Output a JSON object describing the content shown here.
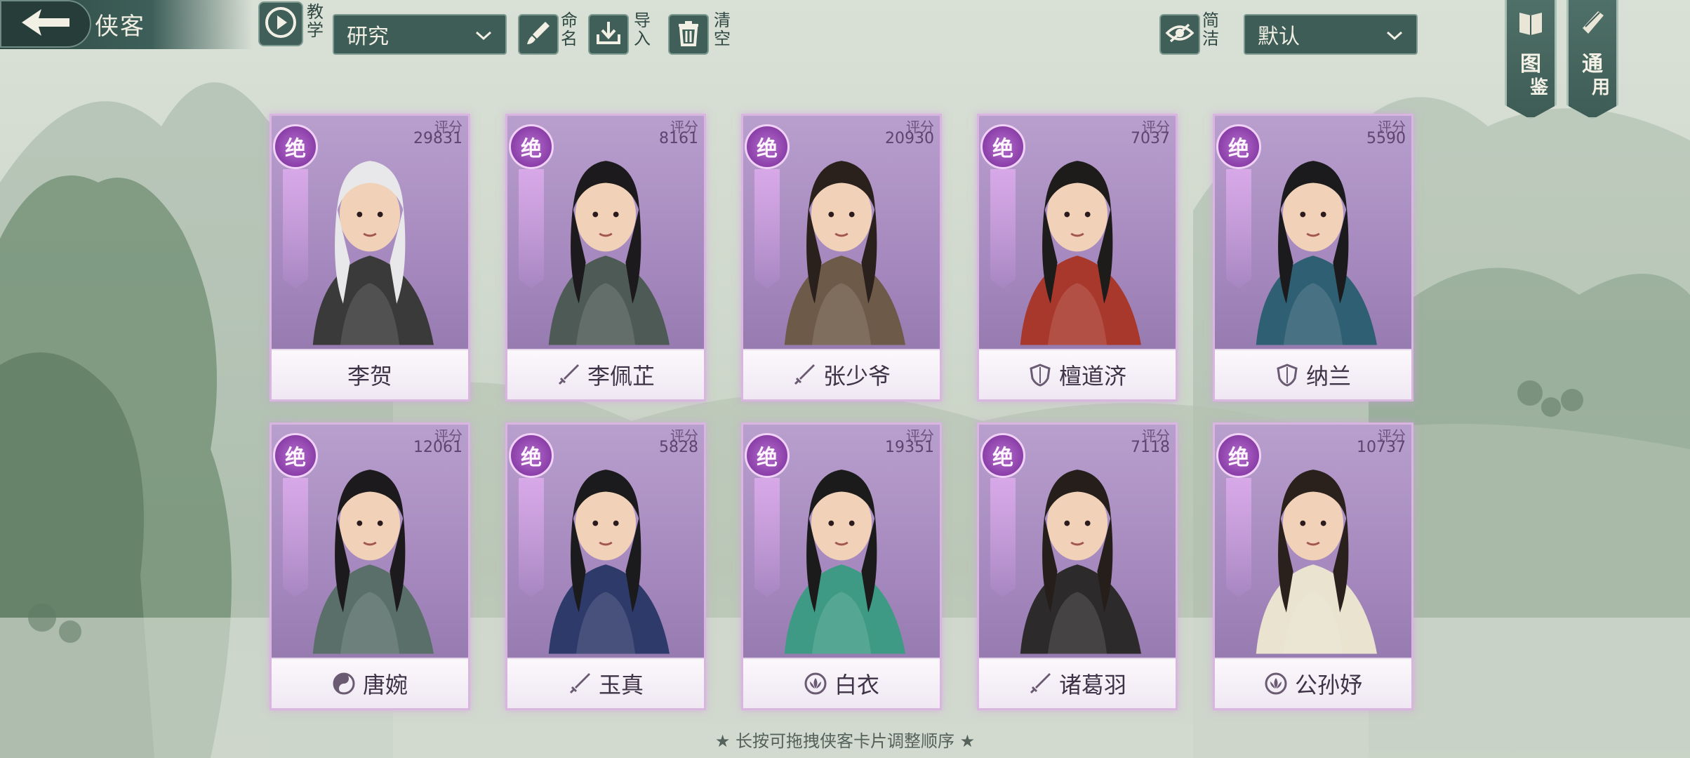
{
  "header": {
    "title": "侠客",
    "tutorial_label": "教学",
    "rename_label": "命名",
    "import_label": "导入",
    "clear_label": "清空",
    "simple_label": "简洁",
    "filter_dropdown": {
      "selected": "研究"
    },
    "sort_dropdown": {
      "selected": "默认"
    }
  },
  "bookmarks": [
    {
      "label_top": "图",
      "label_bottom": "鉴"
    },
    {
      "label_top": "通",
      "label_bottom": "用"
    }
  ],
  "score_label": "评分",
  "rank_label": "绝",
  "cards": [
    {
      "name": "李贺",
      "score": "29831",
      "class_icon": "none",
      "robe": "#3b3a3a",
      "hair": "#e8e8ea"
    },
    {
      "name": "李佩芷",
      "score": "8161",
      "class_icon": "sword-icon",
      "robe": "#4e5a56",
      "hair": "#1c1a1c"
    },
    {
      "name": "张少爷",
      "score": "20930",
      "class_icon": "sword-icon",
      "robe": "#6e5a48",
      "hair": "#2a211c"
    },
    {
      "name": "檀道济",
      "score": "7037",
      "class_icon": "shield-icon",
      "robe": "#a8382c",
      "hair": "#1e1b1b"
    },
    {
      "name": "纳兰",
      "score": "5590",
      "class_icon": "shield-icon",
      "robe": "#2f5f73",
      "hair": "#1b1b1e"
    },
    {
      "name": "唐婉",
      "score": "12061",
      "class_icon": "taiji-icon",
      "robe": "#5b6f6a",
      "hair": "#1d1a1d"
    },
    {
      "name": "玉真",
      "score": "5828",
      "class_icon": "sword-icon",
      "robe": "#2e3a6a",
      "hair": "#1b1a1c"
    },
    {
      "name": "白衣",
      "score": "19351",
      "class_icon": "lotus-icon",
      "robe": "#3e9a84",
      "hair": "#1b1b1b"
    },
    {
      "name": "诸葛羽",
      "score": "7118",
      "class_icon": "sword-icon",
      "robe": "#2d2a2c",
      "hair": "#251e1b"
    },
    {
      "name": "公孙妤",
      "score": "10737",
      "class_icon": "lotus-icon",
      "robe": "#e9e3cf",
      "hair": "#2a201c"
    }
  ],
  "hint": "★ 长按可拖拽侠客卡片调整顺序 ★",
  "colors": {
    "accent": "#3d5d56",
    "card_purple": "#a487bd",
    "card_border": "#d9b6e0"
  }
}
